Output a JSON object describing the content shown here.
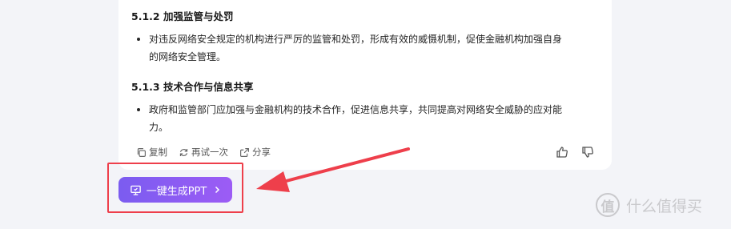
{
  "content": {
    "section_1": {
      "title": "5.1.2 加强监管与处罚",
      "bullet_line_1": "对违反网络安全规定的机构进行严厉的监管和处罚，形成有效的威慑机制，促使金融机构加强自身",
      "bullet_line_2": "的网络安全管理。"
    },
    "section_2": {
      "title": "5.1.3 技术合作与信息共享",
      "bullet_line_1": "政府和监管部门应加强与金融机构的技术合作，促进信息共享，共同提高对网络安全威胁的应对能",
      "bullet_line_2": "力。"
    }
  },
  "actions": {
    "copy_label": "复制",
    "retry_label": "再试一次",
    "share_label": "分享"
  },
  "ppt_button": {
    "label": "一键生成PPT"
  },
  "watermark": {
    "logo_text": "值",
    "text": "什么值得买"
  },
  "colors": {
    "page_background": "#f3f4f8",
    "card_background": "#ffffff",
    "button_gradient_start": "#7b5cf0",
    "button_gradient_end": "#9c5cf5",
    "annotation_red": "#ee3f4b"
  },
  "icons": [
    "copy-icon",
    "retry-icon",
    "share-icon",
    "thumbs-up-icon",
    "thumbs-down-icon",
    "presentation-icon",
    "chevron-right-icon"
  ]
}
